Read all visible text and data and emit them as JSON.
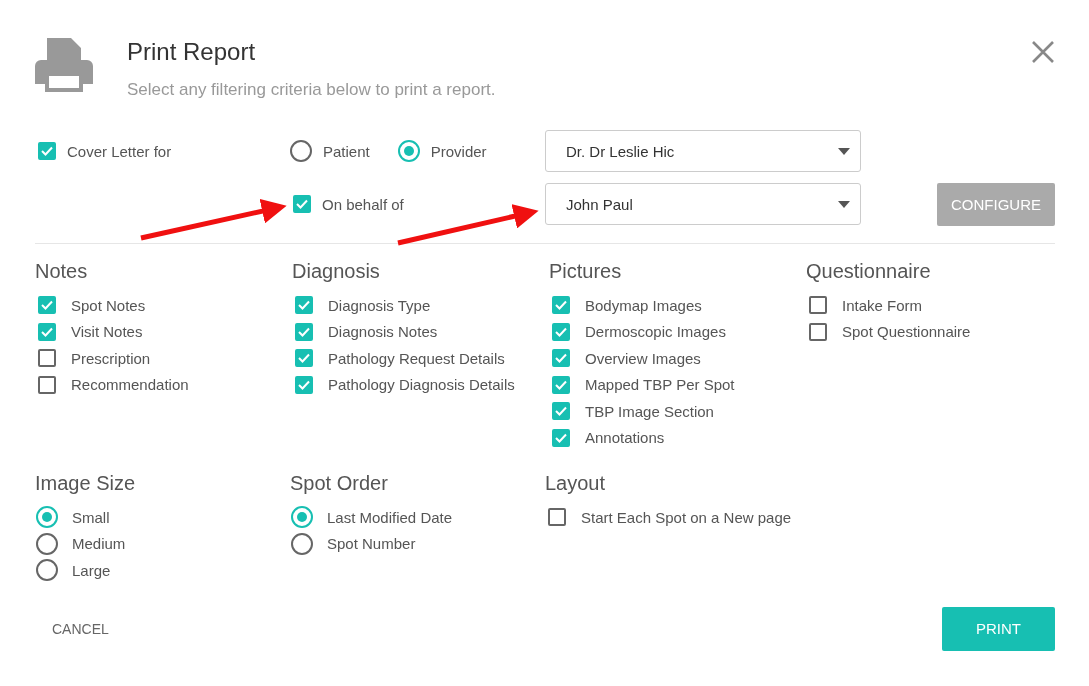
{
  "dialog": {
    "title": "Print Report",
    "subtitle": "Select any filtering criteria below to print a report."
  },
  "cover_letter": {
    "label": "Cover Letter for",
    "checked": true,
    "recipients": [
      {
        "label": "Patient",
        "selected": false
      },
      {
        "label": "Provider",
        "selected": true
      }
    ],
    "provider_select": {
      "value": "Dr. Dr Leslie Hic"
    },
    "on_behalf": {
      "label": "On behalf of",
      "checked": true
    },
    "behalf_select": {
      "value": "John Paul"
    },
    "configure_button": {
      "label": "CONFIGURE",
      "disabled": true
    }
  },
  "sections": [
    {
      "title": "Notes",
      "kind": "checkbox",
      "items": [
        {
          "label": "Spot Notes",
          "checked": true
        },
        {
          "label": "Visit Notes",
          "checked": true
        },
        {
          "label": "Prescription",
          "checked": false
        },
        {
          "label": "Recommendation",
          "checked": false
        }
      ]
    },
    {
      "title": "Diagnosis",
      "kind": "checkbox",
      "items": [
        {
          "label": "Diagnosis Type",
          "checked": true
        },
        {
          "label": "Diagnosis Notes",
          "checked": true
        },
        {
          "label": "Pathology Request Details",
          "checked": true
        },
        {
          "label": "Pathology Diagnosis Details",
          "checked": true
        }
      ]
    },
    {
      "title": "Pictures",
      "kind": "checkbox",
      "items": [
        {
          "label": "Bodymap Images",
          "checked": true
        },
        {
          "label": "Dermoscopic Images",
          "checked": true
        },
        {
          "label": "Overview Images",
          "checked": true
        },
        {
          "label": "Mapped TBP Per Spot",
          "checked": true
        },
        {
          "label": "TBP Image Section",
          "checked": true
        },
        {
          "label": "Annotations",
          "checked": true
        }
      ]
    },
    {
      "title": "Questionnaire",
      "kind": "checkbox",
      "items": [
        {
          "label": "Intake Form",
          "checked": false
        },
        {
          "label": "Spot Questionnaire",
          "checked": false
        }
      ]
    }
  ],
  "options": [
    {
      "title": "Image Size",
      "kind": "radio",
      "items": [
        {
          "label": "Small",
          "selected": true
        },
        {
          "label": "Medium",
          "selected": false
        },
        {
          "label": "Large",
          "selected": false
        }
      ]
    },
    {
      "title": "Spot Order",
      "kind": "radio",
      "items": [
        {
          "label": "Last Modified Date",
          "selected": true
        },
        {
          "label": "Spot Number",
          "selected": false
        }
      ]
    },
    {
      "title": "Layout",
      "kind": "checkbox",
      "items": [
        {
          "label": "Start Each Spot on a New page",
          "checked": false
        }
      ]
    }
  ],
  "buttons": {
    "cancel": "CANCEL",
    "print": "PRINT"
  }
}
